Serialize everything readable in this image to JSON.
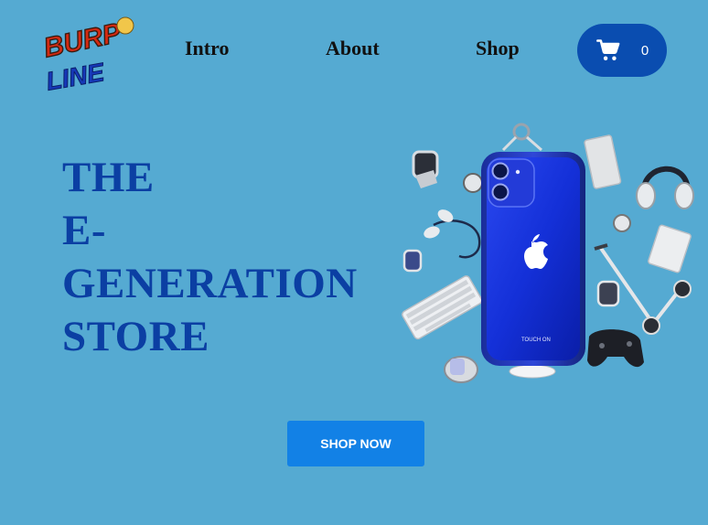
{
  "brand": {
    "logo_line1": "BURP",
    "logo_line2": "LINE"
  },
  "nav": {
    "items": [
      {
        "label": "Intro"
      },
      {
        "label": "About"
      },
      {
        "label": "Shop"
      }
    ]
  },
  "cart": {
    "count": "0",
    "icon": "cart-icon"
  },
  "hero": {
    "title_lines": [
      "THE",
      "E-",
      "GENERATION",
      "STORE"
    ]
  },
  "cta": {
    "label": "SHOP NOW"
  },
  "product": {
    "phone_brand_text": "TOUCH ON"
  },
  "colors": {
    "background": "#55aad2",
    "title": "#0b3fa3",
    "cart_button": "#0a4db0",
    "cta_button": "#1281e6"
  }
}
